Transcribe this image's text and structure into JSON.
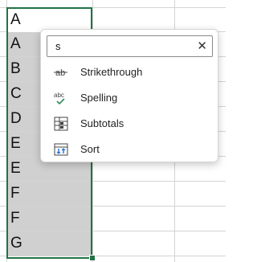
{
  "sheet": {
    "column_cells": [
      {
        "value": "A",
        "state": "active"
      },
      {
        "value": "A",
        "state": "selected"
      },
      {
        "value": "B",
        "state": "selected"
      },
      {
        "value": "C",
        "state": "selected"
      },
      {
        "value": "D",
        "state": "selected"
      },
      {
        "value": "E",
        "state": "selected"
      },
      {
        "value": "E",
        "state": "selected"
      },
      {
        "value": "F",
        "state": "selected"
      },
      {
        "value": "F",
        "state": "selected"
      },
      {
        "value": "G",
        "state": "selected"
      }
    ],
    "selection_color": "#217346"
  },
  "popup": {
    "search_value": "s",
    "clear_icon": "close-icon",
    "items": [
      {
        "label": "Strikethrough",
        "icon": "strikethrough-icon"
      },
      {
        "label": "Spelling",
        "icon": "spelling-icon",
        "icon_text": "abc"
      },
      {
        "label": "Subtotals",
        "icon": "subtotals-icon"
      },
      {
        "label": "Sort",
        "icon": "sort-icon"
      }
    ]
  }
}
